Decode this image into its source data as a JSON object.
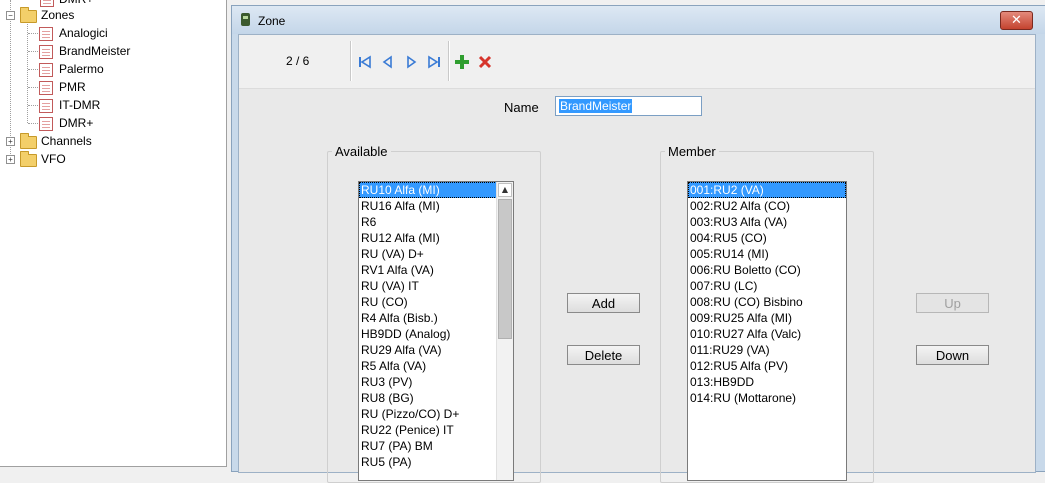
{
  "tree": {
    "partial_top_label": "DMR+",
    "zones_label": "Zones",
    "zone_items": [
      "Analogici",
      "BrandMeister",
      "Palermo",
      "PMR",
      "IT-DMR",
      "DMR+"
    ],
    "channels_label": "Channels",
    "vfo_label": "VFO"
  },
  "window": {
    "title": "Zone",
    "close_glyph": "✕",
    "counter": "2 / 6"
  },
  "form": {
    "name_label": "Name",
    "name_value": "BrandMeister"
  },
  "available": {
    "label": "Available",
    "items": [
      "RU10 Alfa (MI)",
      "RU16 Alfa (MI)",
      "R6",
      "RU12 Alfa (MI)",
      "RU (VA) D+",
      "RV1 Alfa (VA)",
      "RU (VA) IT",
      "RU (CO)",
      "R4 Alfa (Bisb.)",
      "HB9DD (Analog)",
      "RU29 Alfa (VA)",
      "R5 Alfa (VA)",
      "RU3 (PV)",
      "RU8 (BG)",
      "RU (Pizzo/CO) D+",
      "RU22 (Penice) IT",
      "RU7 (PA) BM",
      "RU5 (PA)"
    ],
    "selected_index": 0
  },
  "member": {
    "label": "Member",
    "items": [
      "001:RU2 (VA)",
      "002:RU2 Alfa (CO)",
      "003:RU3 Alfa (VA)",
      "004:RU5 (CO)",
      "005:RU14 (MI)",
      "006:RU Boletto (CO)",
      "007:RU (LC)",
      "008:RU (CO) Bisbino",
      "009:RU25 Alfa (MI)",
      "010:RU27 Alfa (Valc)",
      "011:RU29 (VA)",
      "012:RU5 Alfa (PV)",
      "013:HB9DD",
      "014:RU (Mottarone)"
    ],
    "selected_index": 0
  },
  "buttons": {
    "add": "Add",
    "delete": "Delete",
    "up": "Up",
    "down": "Down"
  },
  "icons": [
    "folder-icon",
    "zone-icon",
    "first-record-icon",
    "previous-record-icon",
    "next-record-icon",
    "last-record-icon",
    "add-record-icon",
    "delete-record-icon",
    "close-icon",
    "scroll-up-icon"
  ],
  "colors": {
    "selection": "#3399ff",
    "title_bar": "#c8d9ea",
    "close_button": "#c4432f",
    "nav_icons": "#3a7bd5",
    "add_icon": "#2f9e2f",
    "delete_icon": "#d6342b"
  }
}
